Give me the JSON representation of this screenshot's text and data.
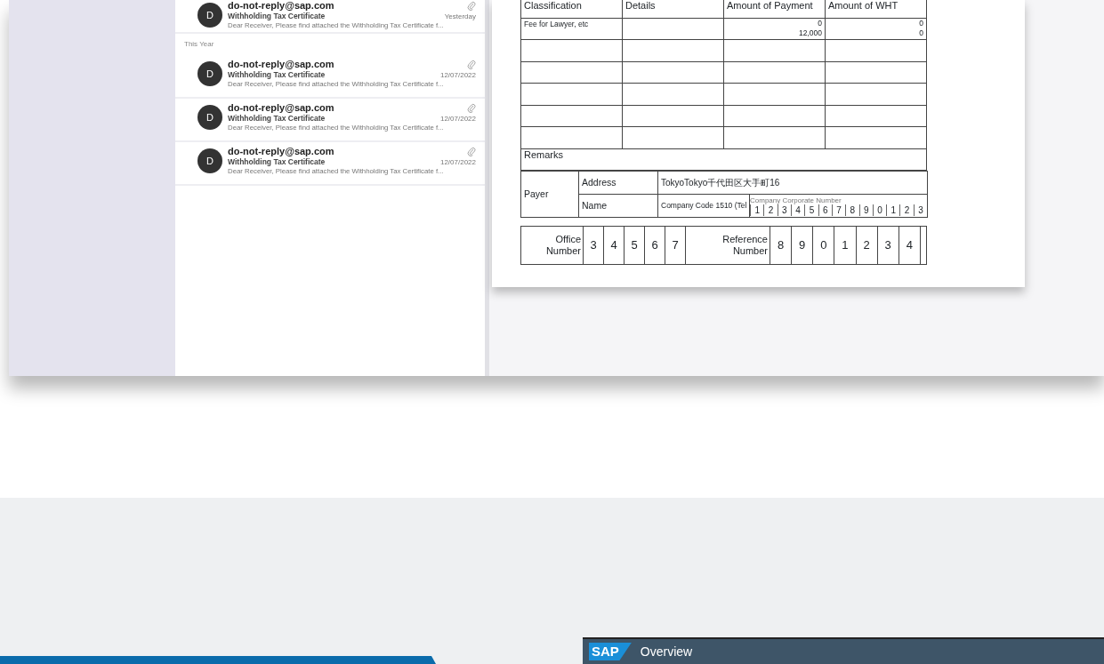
{
  "mail_list": {
    "sections": [
      {
        "messages": [
          {
            "avatar": "D",
            "sender": "do-not-reply@sap.com",
            "subject": "Withholding Tax Certificate",
            "date": "Yesterday",
            "preview": "Dear Receiver, Please find attached the Withholding Tax Certificate f...",
            "attachment": true
          }
        ]
      },
      {
        "heading": "This Year",
        "messages": [
          {
            "avatar": "D",
            "sender": "do-not-reply@sap.com",
            "subject": "Withholding Tax Certificate",
            "date": "12/07/2022",
            "preview": "Dear Receiver, Please find attached the Withholding Tax Certificate f...",
            "attachment": true
          },
          {
            "avatar": "D",
            "sender": "do-not-reply@sap.com",
            "subject": "Withholding Tax Certificate",
            "date": "12/07/2022",
            "preview": "Dear Receiver, Please find attached the Withholding Tax Certificate f...",
            "attachment": true
          },
          {
            "avatar": "D",
            "sender": "do-not-reply@sap.com",
            "subject": "Withholding Tax Certificate",
            "date": "12/07/2022",
            "preview": "Dear Receiver, Please find attached the Withholding Tax Certificate f...",
            "attachment": true
          }
        ]
      }
    ]
  },
  "document": {
    "columns": [
      "Classification",
      "Details",
      "Amount of Payment",
      "Amount of WHT"
    ],
    "rows": [
      {
        "classification": "Fee for Lawyer, etc",
        "amount_of_payment": [
          "0",
          "12,000"
        ],
        "amount_of_wht": [
          "0",
          "0"
        ]
      }
    ],
    "remarks": "Remarks",
    "payer": {
      "label": "Payer",
      "address_label": "Address",
      "address": "TokyoTokyo千代田区大手町16",
      "name_label": "Name",
      "name": "Company Code 1510 (Tel",
      "corporate_number_label": "Company Corporate Number",
      "corporate_number": [
        "1",
        "2",
        "3",
        "4",
        "5",
        "6",
        "7",
        "8",
        "9",
        "0",
        "1",
        "2",
        "3"
      ]
    },
    "office_number": {
      "label": "Office Number",
      "digits": [
        "3",
        "4",
        "5",
        "6",
        "7"
      ]
    },
    "reference_number": {
      "label": "Reference Number",
      "digits": [
        "8",
        "9",
        "0",
        "1",
        "2",
        "3",
        "4"
      ]
    }
  },
  "sap_window": {
    "logo": "SAP",
    "title": "Overview"
  }
}
